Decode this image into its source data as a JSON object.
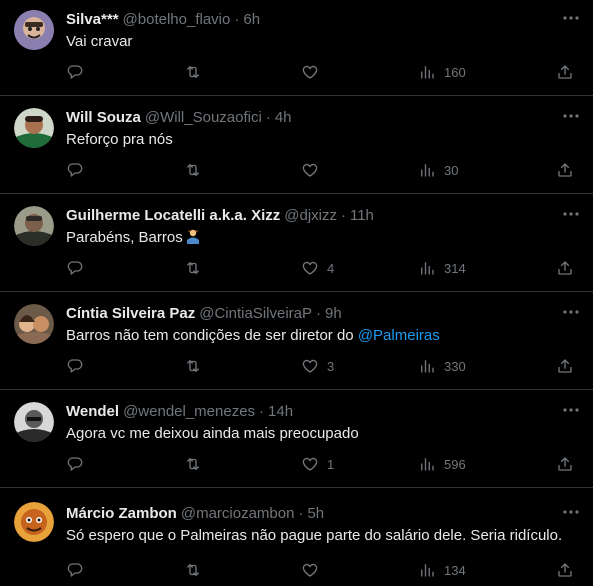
{
  "tweets": [
    {
      "name": "Silva***",
      "handle": "@botelho_flavio",
      "time": "6h",
      "text": "Vai cravar",
      "likes": "",
      "views": "160",
      "avatar_color": "#8b7fb0"
    },
    {
      "name": "Will Souza",
      "handle": "@Will_Souzaofici",
      "time": "4h",
      "text": "Reforço pra nós",
      "likes": "",
      "views": "30",
      "avatar_color": "#3f7a4a"
    },
    {
      "name": "Guilherme Locatelli a.k.a. Xizz",
      "handle": "@djxizz",
      "time": "11h",
      "text": "Parabéns, Barros",
      "emoji": "person-shrugging",
      "likes": "4",
      "views": "314",
      "avatar_color": "#4a4f3e"
    },
    {
      "name": "Cíntia Silveira Paz",
      "handle": "@CintiaSilveiraP",
      "time": "9h",
      "text": "Barros não tem condições de ser diretor do ",
      "mention": "@Palmeiras",
      "likes": "3",
      "views": "330",
      "avatar_color": "#a07a5c"
    },
    {
      "name": "Wendel",
      "handle": "@wendel_menezes",
      "time": "14h",
      "text": "Agora vc me deixou ainda mais preocupado",
      "likes": "1",
      "views": "596",
      "avatar_color": "#7a7a7a"
    },
    {
      "name": "Márcio Zambon",
      "handle": "@marciozambon",
      "time": "5h",
      "text": "Só espero que o Palmeiras não pague parte do salário dele. Seria ridículo.",
      "likes": "",
      "views": "134",
      "avatar_color": "#d08a2a"
    }
  ],
  "colors": {
    "background": "#000000",
    "text": "#e7e9ea",
    "muted": "#71767b",
    "link": "#1d9bf0",
    "divider": "#2f3336"
  },
  "icons": [
    "more-icon",
    "reply-icon",
    "retweet-icon",
    "like-icon",
    "views-icon",
    "share-icon"
  ]
}
